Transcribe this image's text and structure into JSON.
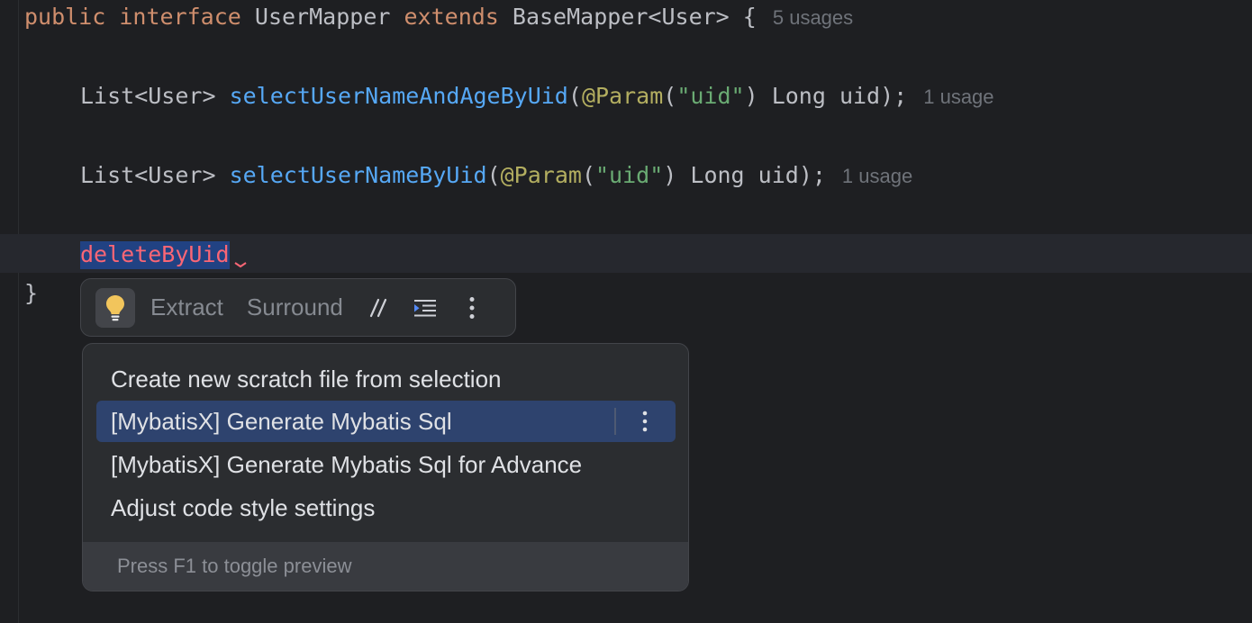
{
  "editor": {
    "line1": {
      "kw_public": "public",
      "kw_interface": "interface",
      "class_name": "UserMapper",
      "kw_extends": "extends",
      "base_type": "BaseMapper<User>",
      "brace_open": "{",
      "usages": "5 usages"
    },
    "line2": {
      "return_type": "List<User>",
      "method_name": "selectUserNameAndAgeByUid",
      "paren_open": "(",
      "annotation": "@Param",
      "anno_paren_open": "(",
      "anno_value": "\"uid\"",
      "anno_paren_close": ")",
      "param": "Long uid",
      "paren_close": ");",
      "usages": "1 usage"
    },
    "line3": {
      "return_type": "List<User>",
      "method_name": "selectUserNameByUid",
      "paren_open": "(",
      "annotation": "@Param",
      "anno_paren_open": "(",
      "anno_value": "\"uid\"",
      "anno_paren_close": ")",
      "param": "Long uid",
      "paren_close": ");",
      "usages": "1 usage"
    },
    "line4": {
      "identifier": "deleteByUid"
    },
    "line5": {
      "brace_close": "}"
    }
  },
  "toolbar": {
    "bulb_icon": "lightbulb-icon",
    "extract_label": "Extract",
    "surround_label": "Surround",
    "comment_icon": "comment-slashes-icon",
    "format_icon": "reformat-icon",
    "more_icon": "vertical-ellipsis-icon"
  },
  "popup": {
    "items": [
      {
        "label": "Create new scratch file from selection"
      },
      {
        "label": "[MybatisX] Generate Mybatis Sql"
      },
      {
        "label": "[MybatisX] Generate Mybatis Sql for Advance"
      },
      {
        "label": "Adjust code style settings"
      }
    ],
    "selected_index": 1,
    "footer": "Press F1 to toggle preview"
  },
  "colors": {
    "background": "#1e1f22",
    "keyword": "#cf8e6d",
    "method": "#56a8f5",
    "annotation": "#b3ae60",
    "string": "#6aab73",
    "error": "#fa6675",
    "selection": "#2e436e"
  }
}
